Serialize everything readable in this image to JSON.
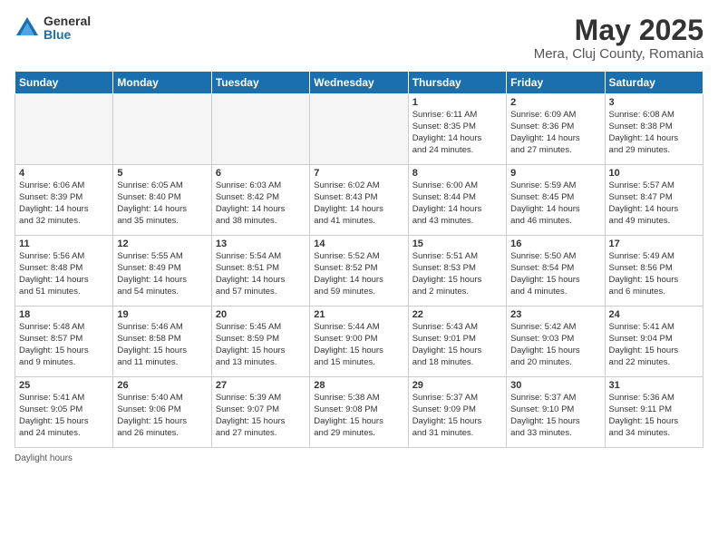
{
  "logo": {
    "general": "General",
    "blue": "Blue"
  },
  "title": "May 2025",
  "subtitle": "Mera, Cluj County, Romania",
  "days_of_week": [
    "Sunday",
    "Monday",
    "Tuesday",
    "Wednesday",
    "Thursday",
    "Friday",
    "Saturday"
  ],
  "weeks": [
    [
      {
        "day": "",
        "empty": true
      },
      {
        "day": "",
        "empty": true
      },
      {
        "day": "",
        "empty": true
      },
      {
        "day": "",
        "empty": true
      },
      {
        "day": "1",
        "info": "Sunrise: 6:11 AM\nSunset: 8:35 PM\nDaylight: 14 hours\nand 24 minutes."
      },
      {
        "day": "2",
        "info": "Sunrise: 6:09 AM\nSunset: 8:36 PM\nDaylight: 14 hours\nand 27 minutes."
      },
      {
        "day": "3",
        "info": "Sunrise: 6:08 AM\nSunset: 8:38 PM\nDaylight: 14 hours\nand 29 minutes."
      }
    ],
    [
      {
        "day": "4",
        "info": "Sunrise: 6:06 AM\nSunset: 8:39 PM\nDaylight: 14 hours\nand 32 minutes."
      },
      {
        "day": "5",
        "info": "Sunrise: 6:05 AM\nSunset: 8:40 PM\nDaylight: 14 hours\nand 35 minutes."
      },
      {
        "day": "6",
        "info": "Sunrise: 6:03 AM\nSunset: 8:42 PM\nDaylight: 14 hours\nand 38 minutes."
      },
      {
        "day": "7",
        "info": "Sunrise: 6:02 AM\nSunset: 8:43 PM\nDaylight: 14 hours\nand 41 minutes."
      },
      {
        "day": "8",
        "info": "Sunrise: 6:00 AM\nSunset: 8:44 PM\nDaylight: 14 hours\nand 43 minutes."
      },
      {
        "day": "9",
        "info": "Sunrise: 5:59 AM\nSunset: 8:45 PM\nDaylight: 14 hours\nand 46 minutes."
      },
      {
        "day": "10",
        "info": "Sunrise: 5:57 AM\nSunset: 8:47 PM\nDaylight: 14 hours\nand 49 minutes."
      }
    ],
    [
      {
        "day": "11",
        "info": "Sunrise: 5:56 AM\nSunset: 8:48 PM\nDaylight: 14 hours\nand 51 minutes."
      },
      {
        "day": "12",
        "info": "Sunrise: 5:55 AM\nSunset: 8:49 PM\nDaylight: 14 hours\nand 54 minutes."
      },
      {
        "day": "13",
        "info": "Sunrise: 5:54 AM\nSunset: 8:51 PM\nDaylight: 14 hours\nand 57 minutes."
      },
      {
        "day": "14",
        "info": "Sunrise: 5:52 AM\nSunset: 8:52 PM\nDaylight: 14 hours\nand 59 minutes."
      },
      {
        "day": "15",
        "info": "Sunrise: 5:51 AM\nSunset: 8:53 PM\nDaylight: 15 hours\nand 2 minutes."
      },
      {
        "day": "16",
        "info": "Sunrise: 5:50 AM\nSunset: 8:54 PM\nDaylight: 15 hours\nand 4 minutes."
      },
      {
        "day": "17",
        "info": "Sunrise: 5:49 AM\nSunset: 8:56 PM\nDaylight: 15 hours\nand 6 minutes."
      }
    ],
    [
      {
        "day": "18",
        "info": "Sunrise: 5:48 AM\nSunset: 8:57 PM\nDaylight: 15 hours\nand 9 minutes."
      },
      {
        "day": "19",
        "info": "Sunrise: 5:46 AM\nSunset: 8:58 PM\nDaylight: 15 hours\nand 11 minutes."
      },
      {
        "day": "20",
        "info": "Sunrise: 5:45 AM\nSunset: 8:59 PM\nDaylight: 15 hours\nand 13 minutes."
      },
      {
        "day": "21",
        "info": "Sunrise: 5:44 AM\nSunset: 9:00 PM\nDaylight: 15 hours\nand 15 minutes."
      },
      {
        "day": "22",
        "info": "Sunrise: 5:43 AM\nSunset: 9:01 PM\nDaylight: 15 hours\nand 18 minutes."
      },
      {
        "day": "23",
        "info": "Sunrise: 5:42 AM\nSunset: 9:03 PM\nDaylight: 15 hours\nand 20 minutes."
      },
      {
        "day": "24",
        "info": "Sunrise: 5:41 AM\nSunset: 9:04 PM\nDaylight: 15 hours\nand 22 minutes."
      }
    ],
    [
      {
        "day": "25",
        "info": "Sunrise: 5:41 AM\nSunset: 9:05 PM\nDaylight: 15 hours\nand 24 minutes."
      },
      {
        "day": "26",
        "info": "Sunrise: 5:40 AM\nSunset: 9:06 PM\nDaylight: 15 hours\nand 26 minutes."
      },
      {
        "day": "27",
        "info": "Sunrise: 5:39 AM\nSunset: 9:07 PM\nDaylight: 15 hours\nand 27 minutes."
      },
      {
        "day": "28",
        "info": "Sunrise: 5:38 AM\nSunset: 9:08 PM\nDaylight: 15 hours\nand 29 minutes."
      },
      {
        "day": "29",
        "info": "Sunrise: 5:37 AM\nSunset: 9:09 PM\nDaylight: 15 hours\nand 31 minutes."
      },
      {
        "day": "30",
        "info": "Sunrise: 5:37 AM\nSunset: 9:10 PM\nDaylight: 15 hours\nand 33 minutes."
      },
      {
        "day": "31",
        "info": "Sunrise: 5:36 AM\nSunset: 9:11 PM\nDaylight: 15 hours\nand 34 minutes."
      }
    ]
  ],
  "footer": "Daylight hours"
}
